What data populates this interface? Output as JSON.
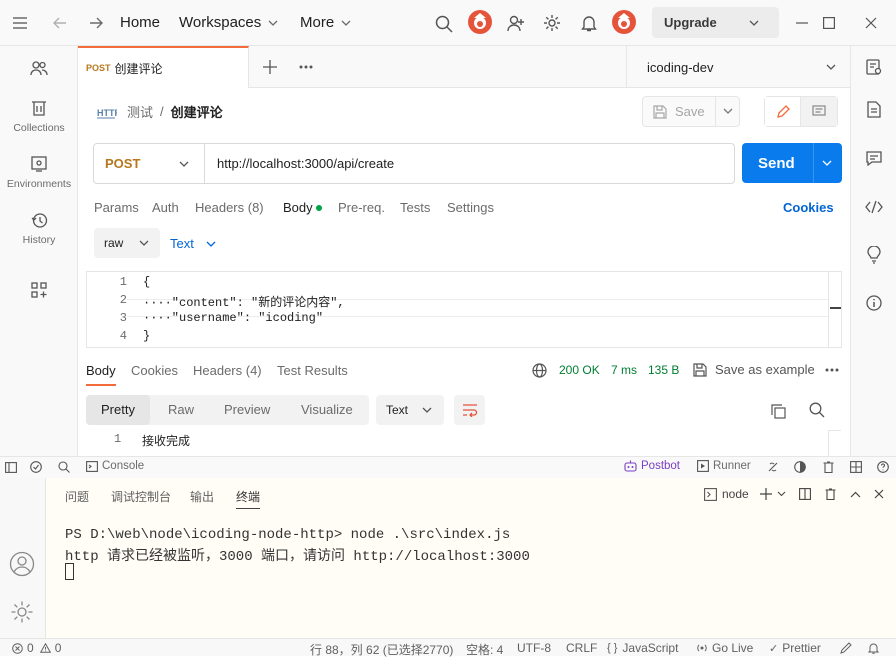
{
  "topbar": {
    "home": "Home",
    "workspaces": "Workspaces",
    "more": "More",
    "upgrade": "Upgrade"
  },
  "sidebar": {
    "items": [
      {
        "label": ""
      },
      {
        "label": "Collections"
      },
      {
        "label": "Environments"
      },
      {
        "label": "History"
      }
    ]
  },
  "tab": {
    "method": "POST",
    "title": "创建评论",
    "environment": "icoding-dev"
  },
  "breadcrumb": {
    "collection": "测试",
    "sep": "/",
    "request": "创建评论",
    "save": "Save"
  },
  "request": {
    "method": "POST",
    "url": "http://localhost:3000/api/create",
    "send": "Send",
    "tabs": [
      "Params",
      "Auth",
      "Headers (8)",
      "Body",
      "Pre-req.",
      "Tests",
      "Settings"
    ],
    "cookies": "Cookies",
    "body_mode": "raw",
    "body_lang": "Text",
    "lines": [
      {
        "n": "1",
        "text": "{"
      },
      {
        "n": "2",
        "text": "····\"content\": \"新的评论内容\","
      },
      {
        "n": "3",
        "text": "····\"username\": \"icoding\""
      },
      {
        "n": "4",
        "text": "}"
      }
    ]
  },
  "response": {
    "tabs": [
      "Body",
      "Cookies",
      "Headers (4)",
      "Test Results"
    ],
    "status": "200 OK",
    "time": "7 ms",
    "size": "135 B",
    "save_example": "Save as example",
    "views": [
      "Pretty",
      "Raw",
      "Preview",
      "Visualize"
    ],
    "format": "Text",
    "line_no": "1",
    "body": "接收完成"
  },
  "pm_status": {
    "console": "Console",
    "postbot": "Postbot",
    "runner": "Runner"
  },
  "terminal": {
    "tabs": [
      "问题",
      "调试控制台",
      "输出",
      "终端"
    ],
    "shell": "node",
    "lines": [
      "PS D:\\web\\node\\icoding-node-http> node .\\src\\index.js",
      "http 请求已经被监听，3000 端口，请访问 http://localhost:3000"
    ]
  },
  "vs_status": {
    "errors": "0",
    "warnings": "0",
    "position": "行 88，列 62 (已选择2770)",
    "spaces": "空格: 4",
    "encoding": "UTF-8",
    "eol": "CRLF",
    "language": "JavaScript",
    "golive": "Go Live",
    "prettier": "Prettier"
  },
  "colors": {
    "accent": "#f26b3a",
    "send": "#097bed",
    "method": "#b7781d",
    "ok": "#007f31",
    "body_dot": "#00a341"
  }
}
